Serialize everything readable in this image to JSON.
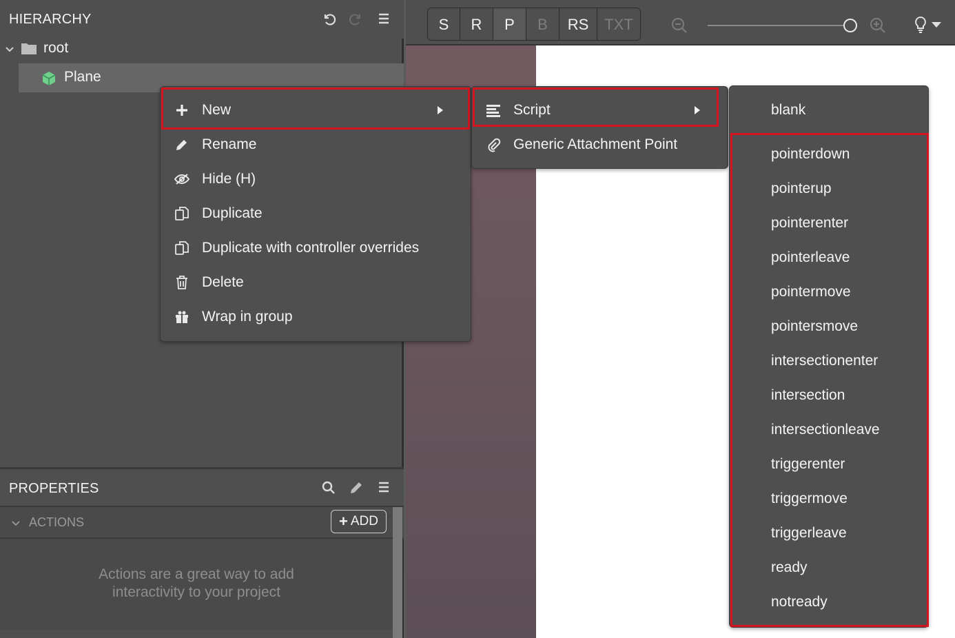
{
  "hierarchy": {
    "title": "HIERARCHY",
    "undo_icon": "undo-icon",
    "redo_icon": "redo-icon",
    "menu_icon": "menu-icon",
    "tree": [
      {
        "label": "root",
        "icon": "folder-icon",
        "expanded": true
      },
      {
        "label": "Plane",
        "icon": "cube-icon",
        "selected": true
      }
    ]
  },
  "properties": {
    "title": "PROPERTIES",
    "section": "ACTIONS",
    "add_label": "ADD",
    "empty_text_line1": "Actions are a great way to add",
    "empty_text_line2": "interactivity to your project"
  },
  "toolbar": {
    "modes": [
      {
        "label": "S",
        "state": "normal"
      },
      {
        "label": "R",
        "state": "normal"
      },
      {
        "label": "P",
        "state": "active"
      },
      {
        "label": "B",
        "state": "disabled"
      },
      {
        "label": "RS",
        "state": "normal"
      },
      {
        "label": "TXT",
        "state": "disabled"
      }
    ],
    "zoom_level": 1.0
  },
  "context_menu": {
    "items": [
      {
        "label": "New",
        "icon": "plus-icon",
        "has_submenu": true,
        "highlighted": true
      },
      {
        "label": "Rename",
        "icon": "pencil-icon"
      },
      {
        "label": "Hide (H)",
        "icon": "eye-slash-icon"
      },
      {
        "label": "Duplicate",
        "icon": "duplicate-icon"
      },
      {
        "label": "Duplicate with controller overrides",
        "icon": "duplicate-icon"
      },
      {
        "label": "Delete",
        "icon": "trash-icon"
      },
      {
        "label": "Wrap in group",
        "icon": "gift-icon"
      }
    ]
  },
  "new_submenu": {
    "items": [
      {
        "label": "Script",
        "icon": "script-lines-icon",
        "has_submenu": true,
        "highlighted": true
      },
      {
        "label": "Generic Attachment Point",
        "icon": "paperclip-icon"
      }
    ]
  },
  "script_submenu": {
    "items": [
      "blank",
      "pointerdown",
      "pointerup",
      "pointerenter",
      "pointerleave",
      "pointermove",
      "pointersmove",
      "intersectionenter",
      "intersection",
      "intersectionleave",
      "triggerenter",
      "triggermove",
      "triggerleave",
      "ready",
      "notready"
    ]
  },
  "colors": {
    "highlight_box": "#d4141e",
    "panel_bg": "#4f4f4f",
    "cube_icon": "#6fd08c"
  }
}
